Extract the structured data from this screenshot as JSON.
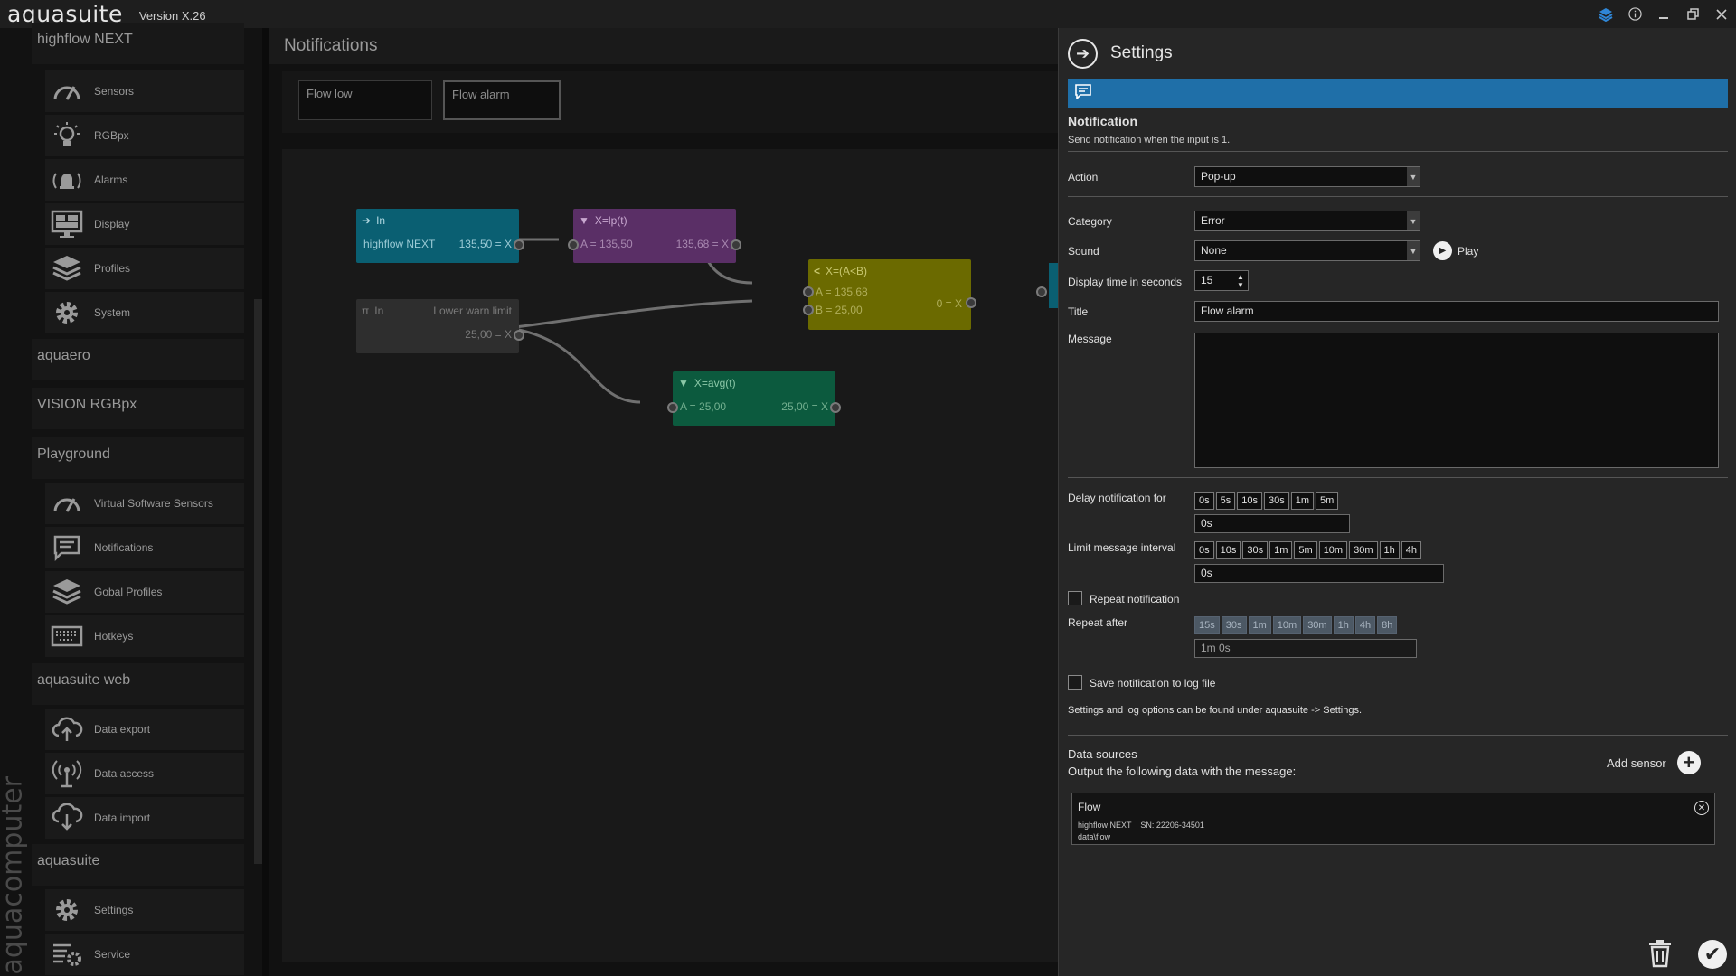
{
  "app": {
    "name": "aquasuite",
    "version": "Version X.26",
    "brand_vertical": "aquacomputer"
  },
  "sidebar": {
    "sections": [
      {
        "title": "highflow NEXT",
        "items": [
          {
            "label": "Sensors",
            "icon": "gauge-icon"
          },
          {
            "label": "RGBpx",
            "icon": "lightbulb-icon"
          },
          {
            "label": "Alarms",
            "icon": "alarm-icon"
          },
          {
            "label": "Display",
            "icon": "display-icon"
          },
          {
            "label": "Profiles",
            "icon": "layers-icon"
          },
          {
            "label": "System",
            "icon": "gear-icon"
          }
        ]
      },
      {
        "title": "aquaero",
        "items": []
      },
      {
        "title": "VISION RGBpx",
        "items": []
      },
      {
        "title": "Playground",
        "items": [
          {
            "label": "Virtual Software Sensors",
            "icon": "gauge-icon"
          },
          {
            "label": "Notifications",
            "icon": "message-icon"
          },
          {
            "label": "Gobal Profiles",
            "icon": "layers-icon"
          },
          {
            "label": "Hotkeys",
            "icon": "keyboard-icon"
          }
        ]
      },
      {
        "title": "aquasuite web",
        "items": [
          {
            "label": "Data export",
            "icon": "cloud-upload-icon"
          },
          {
            "label": "Data access",
            "icon": "antenna-icon"
          },
          {
            "label": "Data import",
            "icon": "cloud-download-icon"
          }
        ]
      },
      {
        "title": "aquasuite",
        "items": [
          {
            "label": "Settings",
            "icon": "gear-icon"
          },
          {
            "label": "Service",
            "icon": "service-icon"
          }
        ]
      }
    ]
  },
  "center": {
    "title": "Notifications",
    "tabs": [
      {
        "label": "Flow low",
        "active": false
      },
      {
        "label": "Flow alarm",
        "active": true
      }
    ],
    "nodes": {
      "in1": {
        "head": "In",
        "left": "highflow NEXT",
        "right": "135,50 = X"
      },
      "lp": {
        "head": "X=lp(t)",
        "left": "A = 135,50",
        "right": "135,68 = X"
      },
      "cmp": {
        "head": "X=(A<B)",
        "rowA": "A = 135,68",
        "rowB": "B = 25,00",
        "out": "0 = X"
      },
      "in2": {
        "head": "In",
        "head_right": "Lower warn limit",
        "right": "25,00 = X"
      },
      "avg": {
        "head": "X=avg(t)",
        "left": "A = 25,00",
        "right": "25,00 = X"
      }
    }
  },
  "settings": {
    "title": "Settings",
    "section_title": "Notification",
    "section_desc": "Send notification when the input is 1.",
    "action": {
      "label": "Action",
      "value": "Pop-up"
    },
    "category": {
      "label": "Category",
      "value": "Error"
    },
    "sound": {
      "label": "Sound",
      "value": "None",
      "play_label": "Play"
    },
    "display_time": {
      "label": "Display time in seconds",
      "value": "15"
    },
    "title_field": {
      "label": "Title",
      "value": "Flow alarm"
    },
    "message": {
      "label": "Message",
      "value": ""
    },
    "delay": {
      "label": "Delay notification for",
      "options": [
        "0s",
        "5s",
        "10s",
        "30s",
        "1m",
        "5m"
      ],
      "value": "0s"
    },
    "limit": {
      "label": "Limit message interval",
      "options": [
        "0s",
        "10s",
        "30s",
        "1m",
        "5m",
        "10m",
        "30m",
        "1h",
        "4h"
      ],
      "value": "0s"
    },
    "repeat": {
      "label": "Repeat notification",
      "checked": false
    },
    "repeat_after": {
      "label": "Repeat after",
      "options": [
        "15s",
        "30s",
        "1m",
        "10m",
        "30m",
        "1h",
        "4h",
        "8h"
      ],
      "value": "1m 0s"
    },
    "save_log": {
      "label": "Save notification to log file",
      "checked": false
    },
    "log_hint": "Settings and log options can be found under aquasuite -> Settings.",
    "data_sources": {
      "title": "Data sources",
      "desc": "Output the following data with the message:",
      "add_label": "Add sensor",
      "items": [
        {
          "name": "Flow",
          "meta": "highflow NEXT    SN: 22206-34501",
          "path": "data\\flow"
        }
      ]
    }
  },
  "colors": {
    "accent": "#1f6fa8",
    "node_in": "#0a5f72",
    "node_lp": "#5a2f66",
    "node_cmp": "#6b6a00",
    "node_avg": "#0c5a3e",
    "node_const": "#2e2e2e"
  }
}
